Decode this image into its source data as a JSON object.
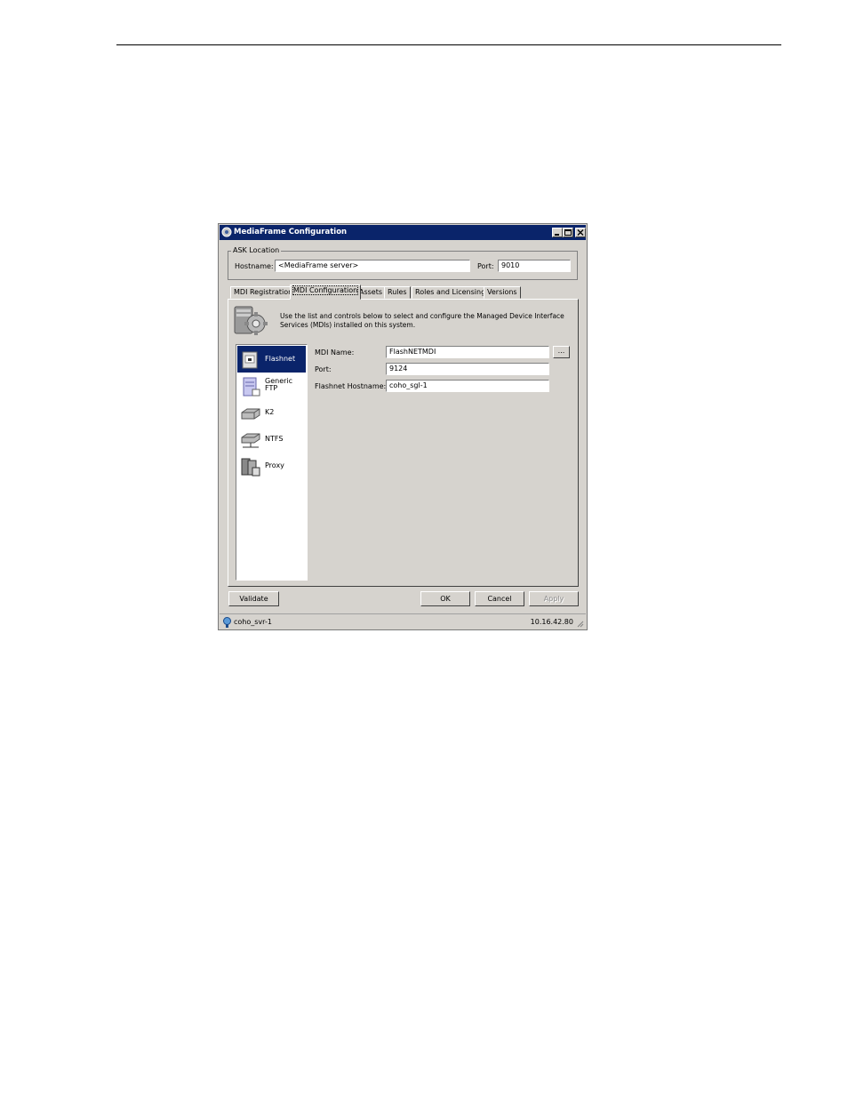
{
  "window": {
    "title": "MediaFrame Configuration"
  },
  "ask_location": {
    "legend": "ASK Location",
    "hostname_label": "Hostname:",
    "hostname_value": "<MediaFrame server>",
    "port_label": "Port:",
    "port_value": "9010"
  },
  "tabs": [
    {
      "label": "MDI Registration"
    },
    {
      "label": "MDI Configuration"
    },
    {
      "label": "Assets"
    },
    {
      "label": "Rules"
    },
    {
      "label": "Roles and Licensing"
    },
    {
      "label": "Versions"
    }
  ],
  "active_tab": "MDI Configuration",
  "description": "Use the list and controls below to select and configure the Managed Device Interface Services (MDIs) installed on this system.",
  "mdi_list": [
    {
      "label": "Flashnet",
      "icon": "server-icon"
    },
    {
      "label_line1": "Generic",
      "label_line2": "FTP",
      "icon": "ftp-server-icon"
    },
    {
      "label": "K2",
      "icon": "drive-icon"
    },
    {
      "label": "NTFS",
      "icon": "network-drive-icon"
    },
    {
      "label": "Proxy",
      "icon": "proxy-server-icon"
    }
  ],
  "selected_mdi": "Flashnet",
  "form": {
    "mdi_name_label": "MDI Name:",
    "mdi_name_value": "FlashNETMDI",
    "browse_label": "...",
    "port_label": "Port:",
    "port_value": "9124",
    "hostname_label": "Flashnet Hostname:",
    "hostname_value": "coho_sgl-1"
  },
  "buttons": {
    "validate": "Validate",
    "ok": "OK",
    "cancel": "Cancel",
    "apply": "Apply"
  },
  "status": {
    "server": "coho_svr-1",
    "ip": "10.16.42.80"
  },
  "colors": {
    "title_bar": "#0a246a",
    "dialog_bg": "#d6d3ce",
    "selection": "#0a246a"
  }
}
